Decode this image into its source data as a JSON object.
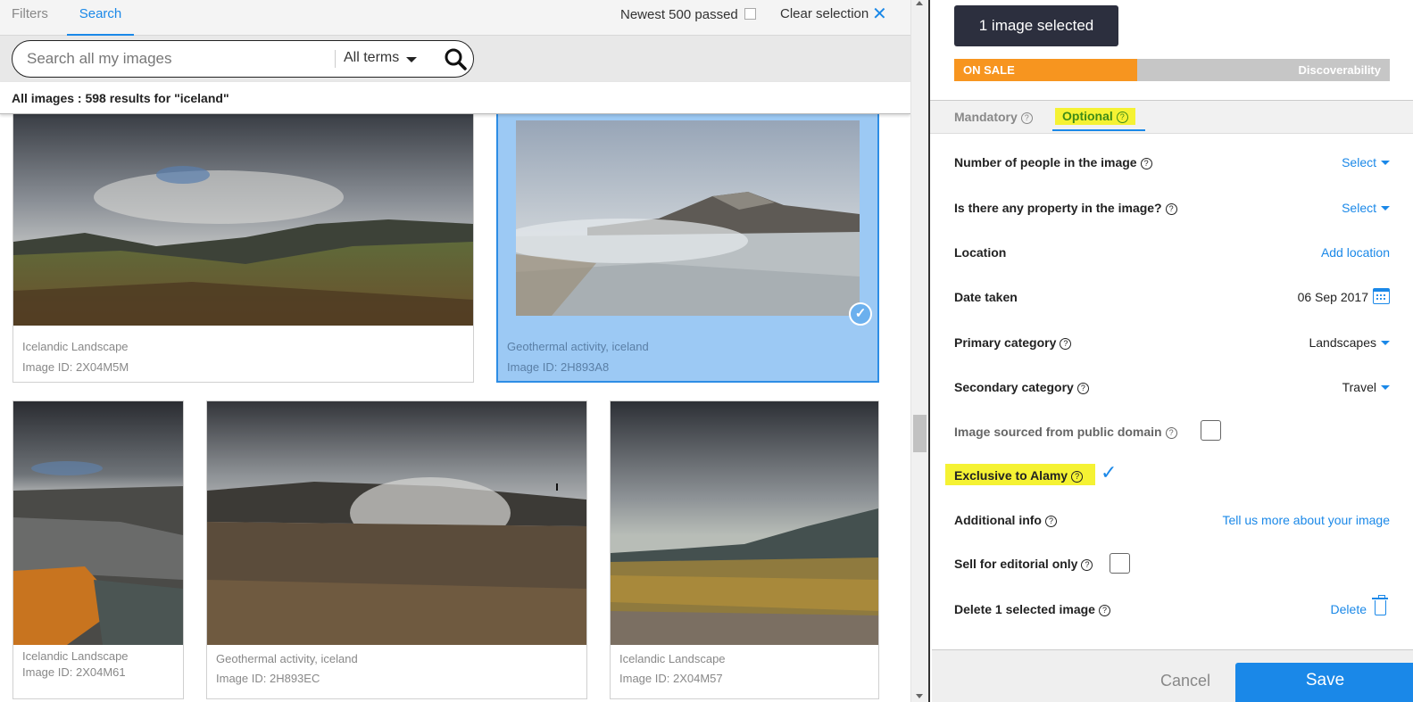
{
  "tabs": {
    "filters": "Filters",
    "search": "Search"
  },
  "header": {
    "newest_label": "Newest 500 passed",
    "clear_label": "Clear selection"
  },
  "search": {
    "placeholder": "Search all my images",
    "terms": "All terms"
  },
  "results_text": "All images : 598 results for \"iceland\"",
  "images": [
    {
      "title": "Icelandic Landscape",
      "id": "Image ID: 2X04M5M",
      "selected": false
    },
    {
      "title": "Geothermal activity, iceland",
      "id": "Image ID: 2H893A8",
      "selected": true
    },
    {
      "title": "Icelandic Landscape",
      "id": "Image ID: 2X04M61",
      "selected": false
    },
    {
      "title": "Geothermal activity, iceland",
      "id": "Image ID: 2H893EC",
      "selected": false
    },
    {
      "title": "Icelandic Landscape",
      "id": "Image ID: 2X04M57",
      "selected": false
    }
  ],
  "panel": {
    "selected_label": "1 image selected",
    "onsale": "ON SALE",
    "discoverability": "Discoverability",
    "discoverability_fraction": 0.42,
    "tab_mandatory": "Mandatory",
    "tab_optional": "Optional",
    "fields": {
      "people": {
        "label": "Number of people in the image",
        "value": "Select"
      },
      "property": {
        "label": "Is there any property in the image?",
        "value": "Select"
      },
      "location": {
        "label": "Location",
        "value": "Add location"
      },
      "date": {
        "label": "Date taken",
        "value": "06 Sep 2017"
      },
      "primary": {
        "label": "Primary category",
        "value": "Landscapes"
      },
      "secondary": {
        "label": "Secondary category",
        "value": "Travel"
      },
      "public_domain": {
        "label": "Image sourced from public domain",
        "checked": false
      },
      "exclusive": {
        "label": "Exclusive to Alamy",
        "checked": true
      },
      "additional": {
        "label": "Additional info",
        "value": "Tell us more about your image"
      },
      "editorial": {
        "label": "Sell for editorial only",
        "checked": false
      },
      "delete": {
        "label": "Delete 1 selected image",
        "value": "Delete"
      }
    },
    "cancel": "Cancel",
    "save": "Save"
  },
  "colors": {
    "accent": "#1a88e8",
    "onsale": "#f7951f",
    "highlight": "#f5f233",
    "selected_bg": "#9cc9f4"
  }
}
